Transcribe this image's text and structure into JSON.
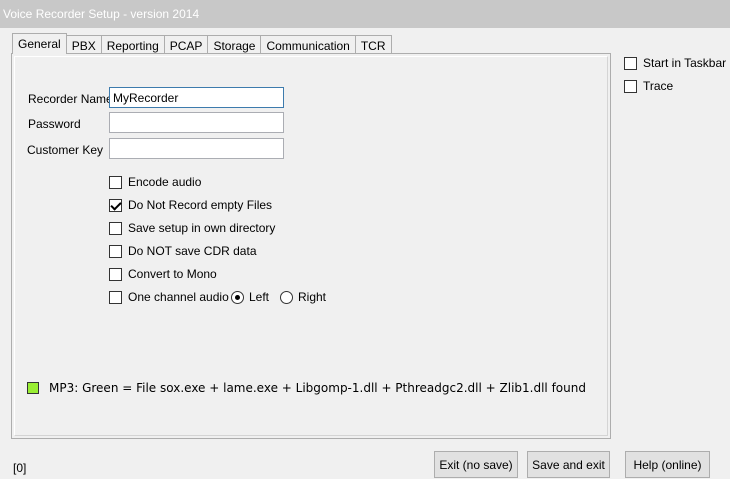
{
  "window": {
    "title": "Voice Recorder Setup - version 2014"
  },
  "tabs": [
    {
      "label": "General",
      "active": true
    },
    {
      "label": "PBX",
      "active": false
    },
    {
      "label": "Reporting",
      "active": false
    },
    {
      "label": "PCAP",
      "active": false
    },
    {
      "label": "Storage",
      "active": false
    },
    {
      "label": "Communication",
      "active": false
    },
    {
      "label": "TCR",
      "active": false
    }
  ],
  "general": {
    "recorder_name": {
      "label": "Recorder Name",
      "value": "MyRecorder"
    },
    "password": {
      "label": "Password",
      "value": ""
    },
    "customer_key": {
      "label": "Customer Key",
      "value": ""
    },
    "options": [
      {
        "label": "Encode audio",
        "checked": false
      },
      {
        "label": "Do Not Record empty Files",
        "checked": true
      },
      {
        "label": "Save setup in own directory",
        "checked": false
      },
      {
        "label": "Do NOT save CDR data",
        "checked": false
      },
      {
        "label": "Convert to Mono",
        "checked": false
      },
      {
        "label": "One channel audio",
        "checked": false
      }
    ],
    "channel": {
      "left_label": "Left",
      "right_label": "Right",
      "selected": "Left"
    },
    "status": {
      "swatch_color": "#99ee33",
      "text": "MP3: Green = File sox.exe + lame.exe + Libgomp-1.dll + Pthreadgc2.dll + Zlib1.dll found"
    }
  },
  "side_options": [
    {
      "label": "Start in Taskbar",
      "checked": false
    },
    {
      "label": "Trace",
      "checked": false
    }
  ],
  "footer": {
    "counter": "[0]",
    "exit_label": "Exit (no save)",
    "save_exit_label": "Save and exit",
    "help_label": "Help (online)"
  }
}
